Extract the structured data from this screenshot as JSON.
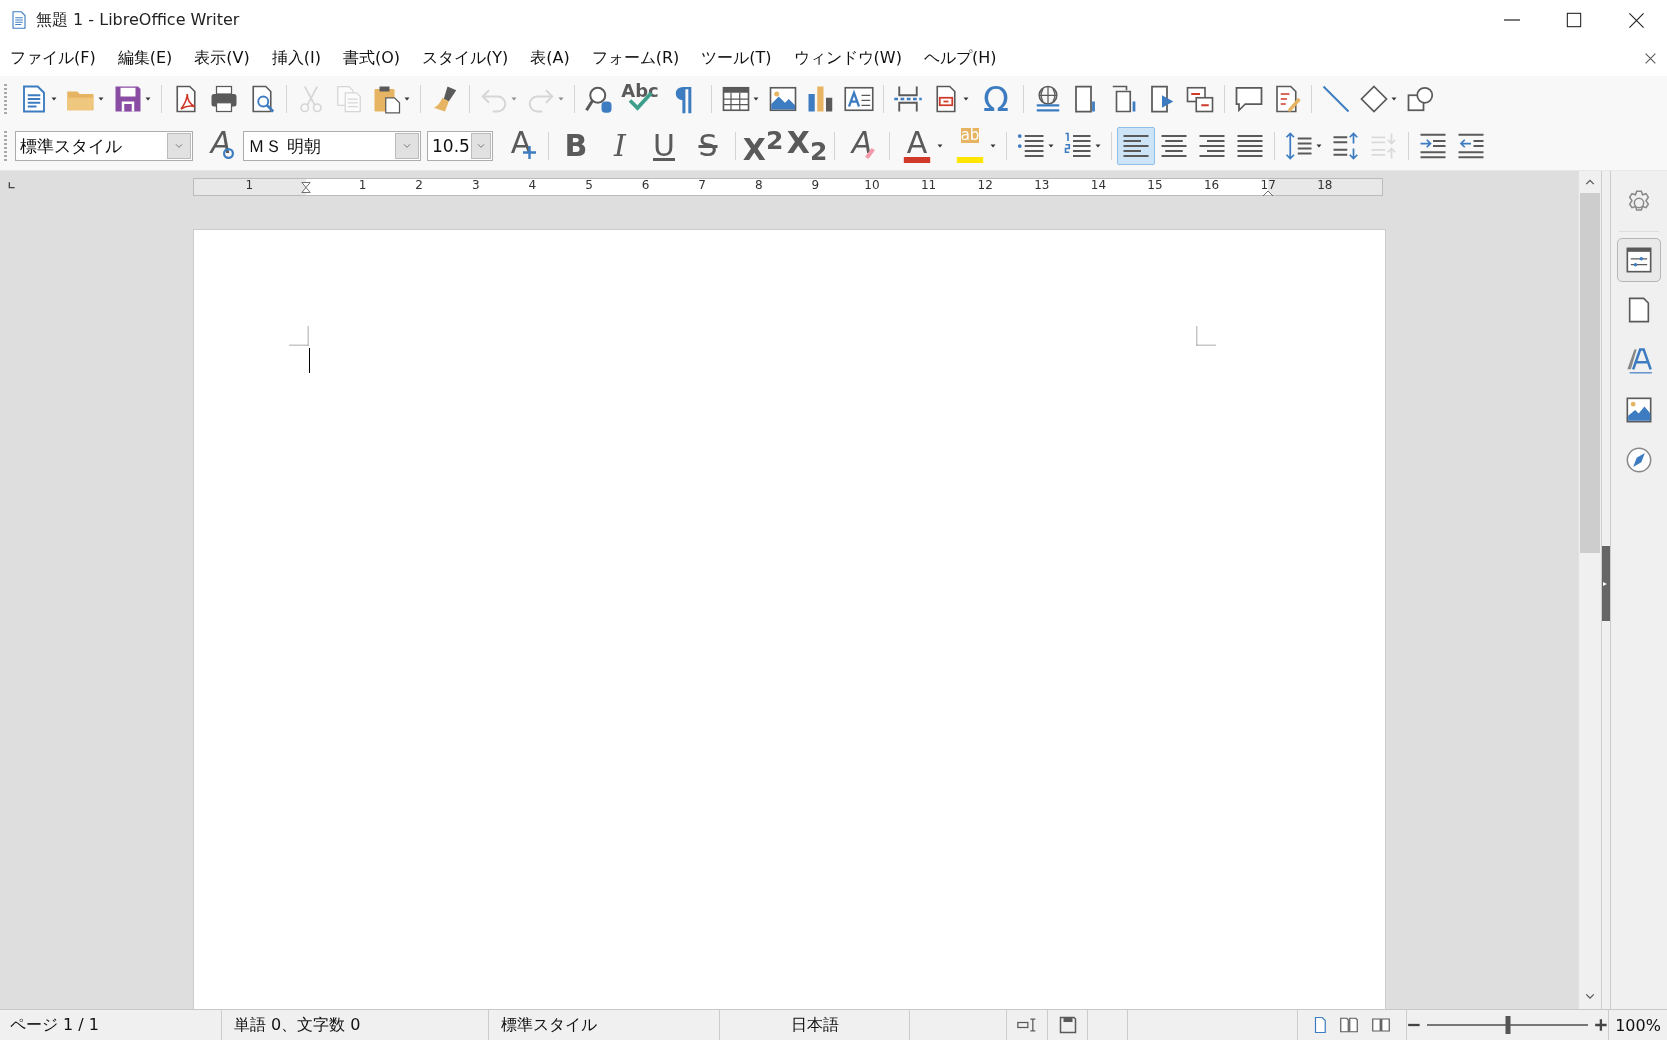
{
  "window": {
    "title": "無題 1 - LibreOffice Writer"
  },
  "menu": [
    {
      "label": "ファイル(F)"
    },
    {
      "label": "編集(E)"
    },
    {
      "label": "表示(V)"
    },
    {
      "label": "挿入(I)"
    },
    {
      "label": "書式(O)"
    },
    {
      "label": "スタイル(Y)"
    },
    {
      "label": "表(A)"
    },
    {
      "label": "フォーム(R)"
    },
    {
      "label": "ツール(T)"
    },
    {
      "label": "ウィンドウ(W)"
    },
    {
      "label": "ヘルプ(H)"
    }
  ],
  "standard_toolbar": [
    {
      "buttons": [
        {
          "disabled": false,
          "dropdown": true
        },
        {
          "disabled": false,
          "dropdown": true
        },
        {
          "disabled": false,
          "dropdown": true
        }
      ]
    },
    {
      "buttons": [
        {
          "disabled": false,
          "dropdown": false
        },
        {
          "disabled": false,
          "dropdown": false
        },
        {
          "disabled": false,
          "dropdown": false
        }
      ]
    },
    {
      "buttons": [
        {
          "disabled": true,
          "dropdown": false
        },
        {
          "disabled": true,
          "dropdown": false
        },
        {
          "disabled": false,
          "dropdown": true
        }
      ]
    },
    {
      "buttons": [
        {
          "disabled": false,
          "dropdown": false
        }
      ]
    },
    {
      "buttons": [
        {
          "disabled": true,
          "dropdown": true
        },
        {
          "disabled": true,
          "dropdown": true
        }
      ]
    },
    {
      "buttons": [
        {
          "disabled": false,
          "dropdown": false
        },
        {
          "disabled": false,
          "dropdown": false,
          "glyph": "Abc"
        },
        {
          "disabled": false,
          "dropdown": false,
          "glyph": "¶"
        }
      ]
    },
    {
      "buttons": [
        {
          "disabled": false,
          "dropdown": true
        },
        {
          "disabled": false,
          "dropdown": false
        },
        {
          "disabled": false,
          "dropdown": false
        },
        {
          "disabled": false,
          "dropdown": false
        }
      ]
    },
    {
      "buttons": [
        {
          "disabled": false,
          "dropdown": false
        },
        {
          "disabled": false,
          "dropdown": true
        },
        {
          "disabled": false,
          "dropdown": false,
          "glyph": "Ω"
        }
      ]
    },
    {
      "buttons": [
        {
          "disabled": false,
          "dropdown": false
        },
        {
          "disabled": false,
          "dropdown": false
        },
        {
          "disabled": false,
          "dropdown": false
        },
        {
          "disabled": false,
          "dropdown": false
        },
        {
          "disabled": false,
          "dropdown": false
        }
      ]
    },
    {
      "buttons": [
        {
          "disabled": false,
          "dropdown": false
        },
        {
          "disabled": false,
          "dropdown": false
        }
      ]
    },
    {
      "buttons": [
        {
          "disabled": false,
          "dropdown": false
        },
        {
          "disabled": false,
          "dropdown": true
        },
        {
          "disabled": false,
          "dropdown": false
        }
      ]
    }
  ],
  "paragraph_style": {
    "value": "標準スタイル"
  },
  "font_name": {
    "value": "ＭＳ 明朝"
  },
  "font_size": {
    "value": "10.5"
  },
  "formatting_toolbar": [
    {
      "buttons": [
        {
          "selected": false,
          "disabled": false,
          "dropdown": false,
          "glyph": "A"
        },
        {
          "selected": false,
          "disabled": false,
          "dropdown": false,
          "glyph": "A"
        }
      ]
    },
    {
      "buttons": [
        {
          "selected": false,
          "disabled": false,
          "dropdown": false,
          "glyph": "B"
        },
        {
          "selected": false,
          "disabled": false,
          "dropdown": false,
          "glyph": "I"
        },
        {
          "selected": false,
          "disabled": false,
          "dropdown": false,
          "glyph": "U"
        },
        {
          "selected": false,
          "disabled": false,
          "dropdown": false,
          "glyph": "S"
        }
      ]
    },
    {
      "buttons": [
        {
          "selected": false,
          "disabled": false,
          "dropdown": false,
          "glyph": "X$^{2}$"
        },
        {
          "selected": false,
          "disabled": false,
          "dropdown": false,
          "glyph": "X$_{2}$"
        }
      ]
    },
    {
      "buttons": [
        {
          "selected": false,
          "disabled": false,
          "dropdown": false,
          "glyph": "A"
        }
      ]
    },
    {
      "buttons": [
        {
          "selected": false,
          "disabled": false,
          "dropdown": true,
          "glyph": "A"
        },
        {
          "selected": false,
          "disabled": false,
          "dropdown": true,
          "glyph": "ab"
        }
      ]
    },
    {
      "buttons": [
        {
          "selected": false,
          "disabled": false,
          "dropdown": true
        },
        {
          "selected": false,
          "disabled": false,
          "dropdown": true
        }
      ]
    },
    {
      "buttons": [
        {
          "selected": true,
          "disabled": false,
          "dropdown": false
        },
        {
          "selected": false,
          "disabled": false,
          "dropdown": false
        },
        {
          "selected": false,
          "disabled": false,
          "dropdown": false
        },
        {
          "selected": false,
          "disabled": false,
          "dropdown": false
        }
      ]
    },
    {
      "buttons": [
        {
          "selected": false,
          "disabled": false,
          "dropdown": true
        },
        {
          "selected": false,
          "disabled": false,
          "dropdown": false
        },
        {
          "selected": false,
          "disabled": true,
          "dropdown": false
        }
      ]
    },
    {
      "buttons": [
        {
          "selected": false,
          "disabled": false,
          "dropdown": false
        },
        {
          "selected": false,
          "disabled": false,
          "dropdown": false
        }
      ]
    }
  ],
  "ruler": {
    "labels": [
      "1",
      "1",
      "2",
      "3",
      "4",
      "5",
      "6",
      "7",
      "8",
      "9",
      "10",
      "11",
      "12",
      "13",
      "14",
      "15",
      "16",
      "17",
      "18"
    ]
  },
  "sidebar_tabs": [
    {
      "selected": false
    },
    {
      "selected": true
    },
    {
      "selected": false
    },
    {
      "selected": false
    },
    {
      "selected": false
    },
    {
      "selected": false
    }
  ],
  "status_bar": {
    "page": "ページ 1 / 1",
    "word_count": "単語 0、文字数 0",
    "style": "標準スタイル",
    "language": "日本語",
    "view_layouts": [
      {
        "selected": true
      },
      {
        "selected": false
      },
      {
        "selected": false
      }
    ],
    "zoom": {
      "level": 0.5
    },
    "zoom_percent": "100%"
  }
}
